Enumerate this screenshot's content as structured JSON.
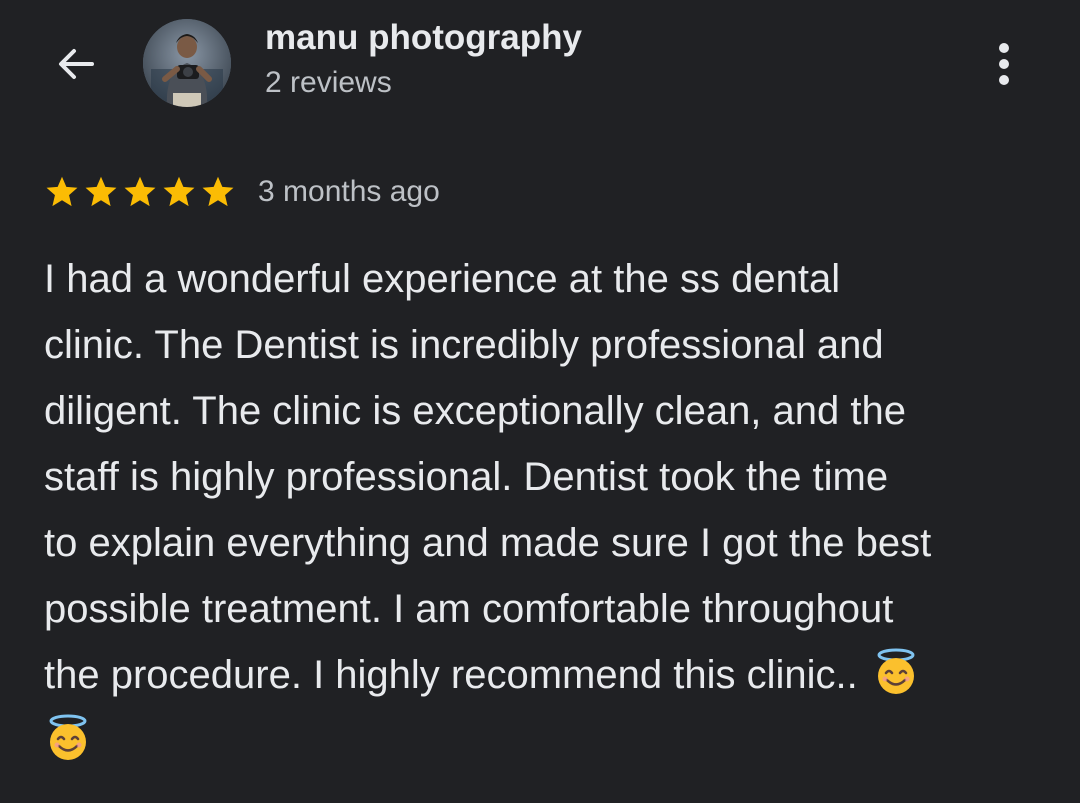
{
  "header": {
    "back_icon": "arrow-left-icon",
    "reviewer_name": "manu photography",
    "review_count": "2 reviews",
    "menu_icon": "more-vertical-icon"
  },
  "review": {
    "rating": 5,
    "rating_max": 5,
    "star_color": "#fbbc04",
    "time": "3 months ago",
    "lines": [
      "I had a wonderful experience at the ss dental",
      "clinic. The Dentist is incredibly professional and",
      "diligent. The clinic is exceptionally clean, and the",
      "staff is highly professional. Dentist took the time",
      "to explain everything and made sure I got the best",
      "possible treatment. I am comfortable throughout",
      "the procedure. I highly recommend this clinic.."
    ],
    "emoji_icon": "smiling-face-with-halo-icon"
  },
  "colors": {
    "background": "#202124",
    "text_primary": "#e8eaed",
    "text_secondary": "#bdc1c6"
  }
}
